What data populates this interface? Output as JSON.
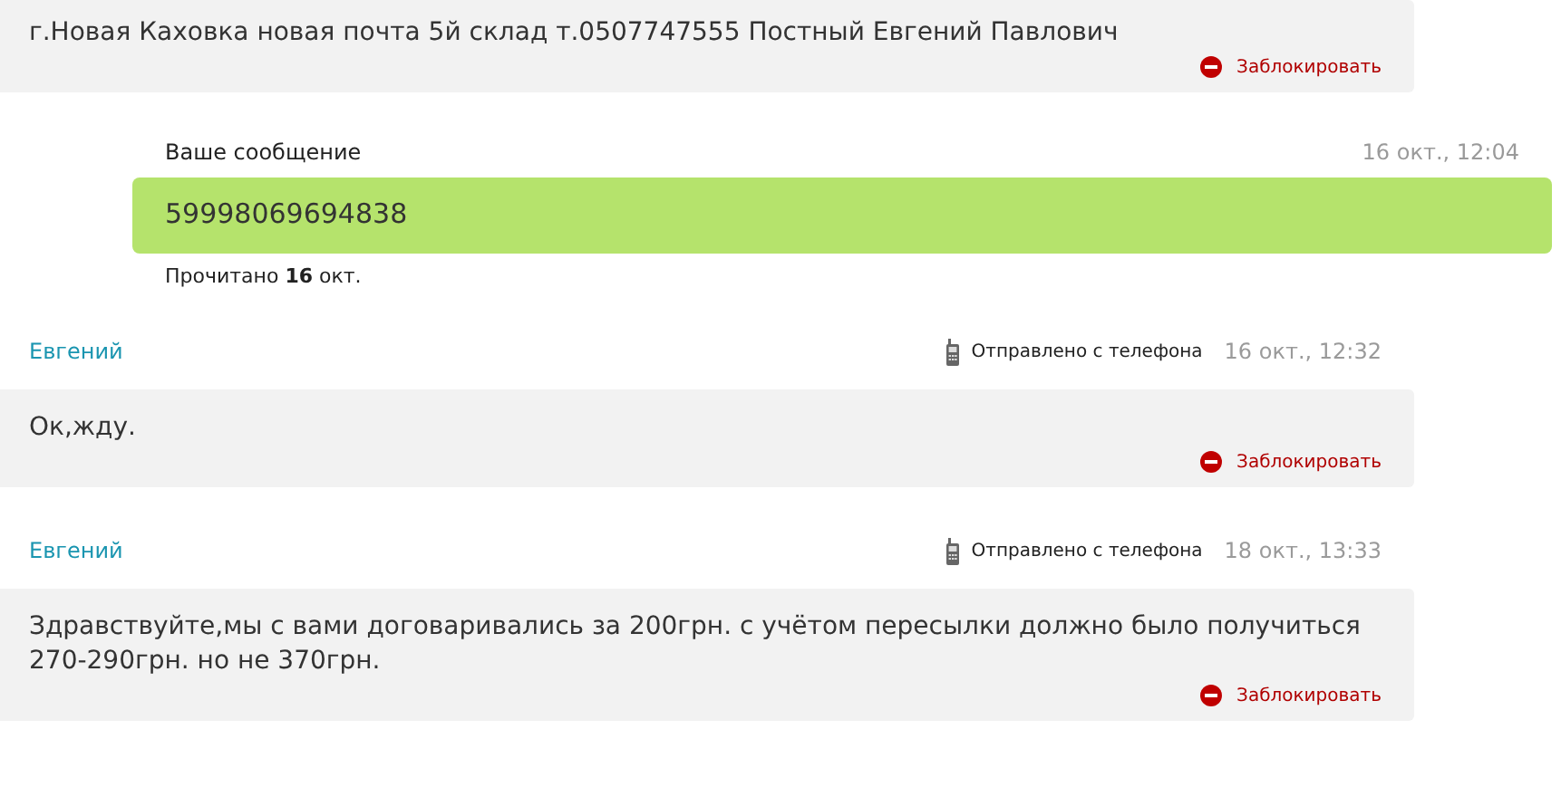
{
  "messages": [
    {
      "kind": "incoming",
      "text": "г.Новая Каховка новая почта 5й склад т.0507747555 Постный Евгений Павлович",
      "block_label": "Заблокировать"
    },
    {
      "kind": "outgoing",
      "label": "Ваше сообщение",
      "time": "16 окт., 12:04",
      "text": "59998069694838",
      "read_status": "Прочитано **16** окт."
    },
    {
      "kind": "incoming",
      "author": "Евгений",
      "device": "Отправлено с телефона",
      "time": "16 окт., 12:32",
      "text": "Ок,жду.",
      "block_label": "Заблокировать"
    },
    {
      "kind": "incoming",
      "author": "Евгений",
      "device": "Отправлено с телефона",
      "time": "18 окт., 13:33",
      "text": "Здравствуйте,мы с вами договаривались за 200грн. с учётом пересылки должно было получиться 270-290грн. но не 370грн.",
      "block_label": "Заблокировать"
    }
  ]
}
